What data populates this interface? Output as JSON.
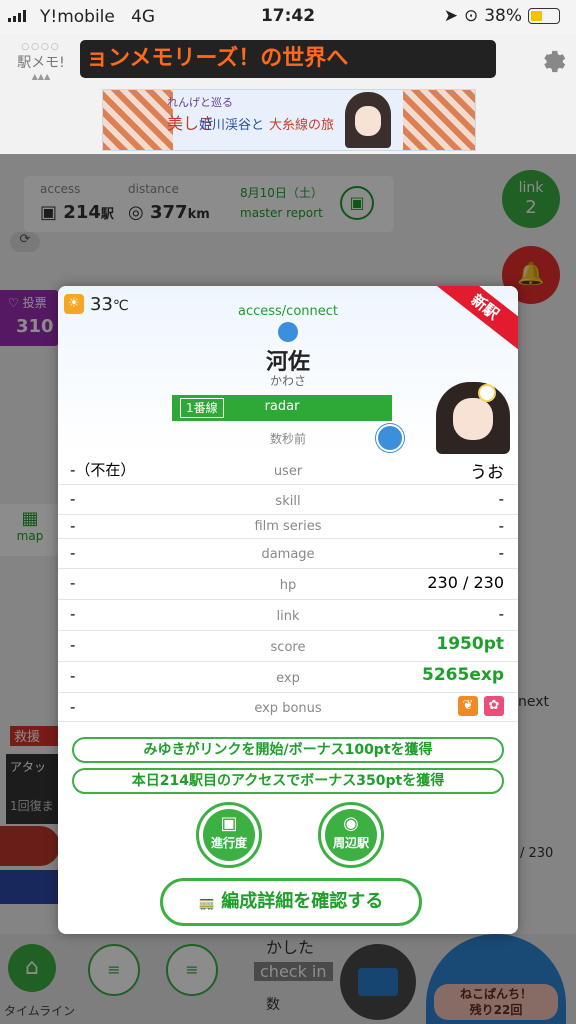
{
  "statusbar": {
    "carrier": "Y!mobile",
    "network": "4G",
    "time": "17:42",
    "battery": "38%"
  },
  "header": {
    "logo_label": "駅メモ!",
    "marquee_text": "ョンメモリーズ！の世界へ",
    "banner": {
      "line1": "れんげと巡る",
      "line2": "美しき",
      "line3": "姫川渓谷と",
      "line4": "大糸線の旅"
    }
  },
  "background": {
    "access_label": "access",
    "access_value": "214",
    "access_unit": "駅",
    "distance_label": "distance",
    "distance_value": "377",
    "distance_unit": "km",
    "report_date": "8月10日（土）",
    "report_label": "master report",
    "link_label": "link",
    "link_count": "2",
    "vote_label": "投票",
    "vote_value": "310",
    "map_label": "map",
    "next_label": "next",
    "rescue_label": "救援",
    "attack_label": "アタッ",
    "recover_label": "1回復ま",
    "hp_side": "/ 230",
    "bottom_text1": "かした",
    "bottom_text2": "check in",
    "bottom_text3": "数",
    "timeline_label": "タイムライン",
    "neko_line1": "ねこぱんち！",
    "neko_line2": "残り22回"
  },
  "modal": {
    "temperature": "33",
    "temp_unit": "℃",
    "new_badge": "新駅",
    "mode": "access/connect",
    "station_name": "河佐",
    "station_reading": "かわさ",
    "line_name": "1番線",
    "radar_label": "radar",
    "time_ago": "数秒前",
    "rows": [
      {
        "left": "-（不在）",
        "label": "user",
        "right": "うお"
      },
      {
        "left": "-",
        "label": "skill",
        "right": "-"
      },
      {
        "left": "-",
        "label": "film series",
        "right": "-"
      },
      {
        "left": "-",
        "label": "damage",
        "right": "-"
      },
      {
        "left": "-",
        "label": "hp",
        "right": "230 / 230"
      },
      {
        "left": "-",
        "label": "link",
        "right": "-"
      },
      {
        "left": "-",
        "label": "score",
        "right": "1950pt"
      },
      {
        "left": "-",
        "label": "exp",
        "right": "5265exp"
      },
      {
        "left": "-",
        "label": "exp bonus",
        "right": ""
      }
    ],
    "bonus1": "みゆきがリンクを開始/ボーナス100ptを獲得",
    "bonus2": "本日214駅目のアクセスでボーナス350ptを獲得",
    "progress_button": "進行度",
    "nearby_button": "周辺駅",
    "formation_button": "編成詳細を確認する"
  },
  "colors": {
    "accent_green": "#3cb043",
    "new_red": "#e31b2e",
    "marquee_orange": "#ff6a1a"
  }
}
